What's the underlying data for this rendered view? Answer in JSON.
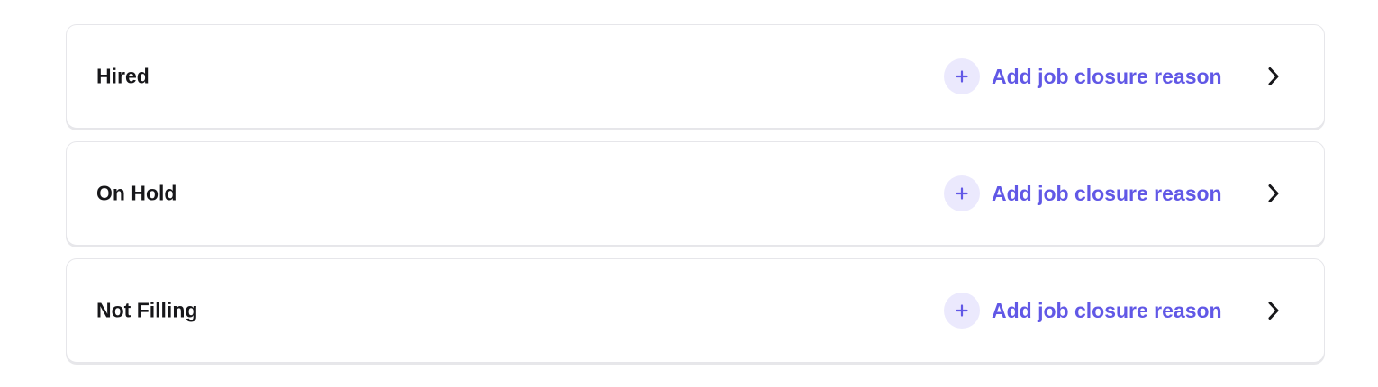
{
  "closure_statuses": [
    {
      "title": "Hired",
      "action_label": "Add job closure reason",
      "action_icon": "plus-icon",
      "expand_icon": "chevron-right-icon"
    },
    {
      "title": "On Hold",
      "action_label": "Add job closure reason",
      "action_icon": "plus-icon",
      "expand_icon": "chevron-right-icon"
    },
    {
      "title": "Not Filling",
      "action_label": "Add job closure reason",
      "action_icon": "plus-icon",
      "expand_icon": "chevron-right-icon"
    }
  ],
  "colors": {
    "accent": "#6158e6",
    "accent_bg": "#ebe9fd",
    "title_text": "#17171a",
    "card_border": "#e6e6ea"
  }
}
